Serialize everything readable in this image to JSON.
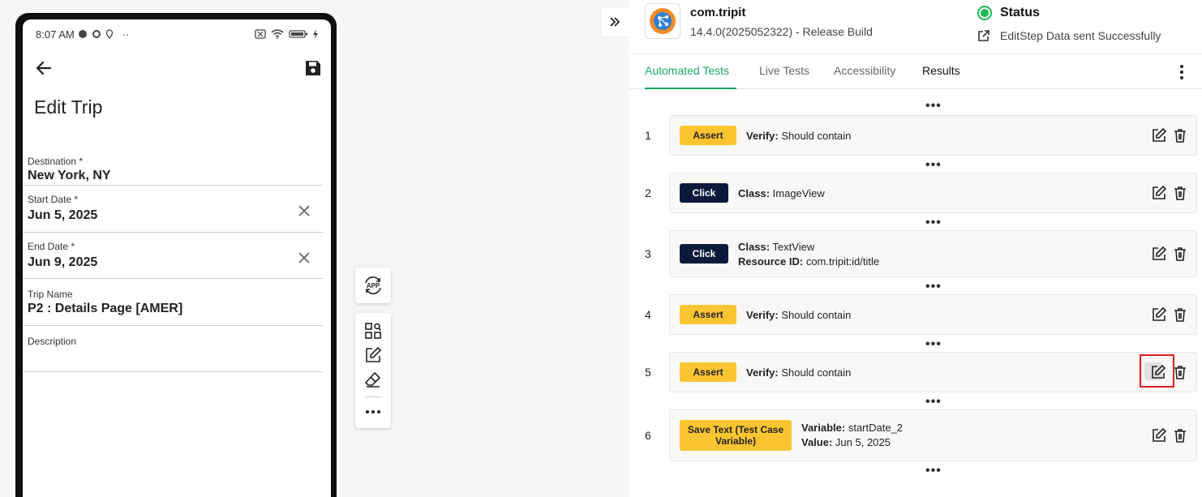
{
  "device": {
    "status_bar": {
      "time": "8:07 AM",
      "overflow": "··"
    },
    "screen_title": "Edit Trip",
    "fields": [
      {
        "label": "Destination *",
        "value": "New York, NY",
        "clearable": false
      },
      {
        "label": "Start Date *",
        "value": "Jun 5, 2025",
        "clearable": true
      },
      {
        "label": "End Date *",
        "value": "Jun 9, 2025",
        "clearable": true
      },
      {
        "label": "Trip Name",
        "value": "P2 : Details Page [AMER]",
        "clearable": false
      },
      {
        "label": "Description",
        "value": "",
        "clearable": false
      }
    ]
  },
  "toolbar": {
    "app_icon_text": "APP",
    "tools": [
      "grid-search-icon",
      "edit-icon",
      "eraser-icon",
      "more-icon"
    ]
  },
  "app": {
    "name": "com.tripit",
    "build": "14.4.0(2025052322) - Release Build",
    "status_title": "Status",
    "status_message": "EditStep Data sent Successfully",
    "status_color": "#1db954"
  },
  "tabs": [
    {
      "label": "Automated Tests",
      "active": true
    },
    {
      "label": "Live Tests",
      "active": false
    },
    {
      "label": "Accessibility",
      "active": false
    },
    {
      "label": "Results",
      "active": false
    }
  ],
  "steps": [
    {
      "num": "1",
      "badge": "Assert",
      "lines": [
        {
          "key": "Verify:",
          "value": "Should contain"
        }
      ]
    },
    {
      "num": "2",
      "badge": "Click",
      "lines": [
        {
          "key": "Class:",
          "value": "ImageView"
        }
      ]
    },
    {
      "num": "3",
      "badge": "Click",
      "lines": [
        {
          "key": "Class:",
          "value": "TextView"
        },
        {
          "key": "Resource ID:",
          "value": "com.tripit:id/title"
        }
      ]
    },
    {
      "num": "4",
      "badge": "Assert",
      "lines": [
        {
          "key": "Verify:",
          "value": "Should contain"
        }
      ]
    },
    {
      "num": "5",
      "badge": "Assert",
      "lines": [
        {
          "key": "Verify:",
          "value": "Should contain"
        }
      ],
      "highlighted": true
    },
    {
      "num": "6",
      "badge": "Save Text (Test Case Variable)",
      "lines": [
        {
          "key": "Variable:",
          "value": "startDate_2"
        },
        {
          "key": "Value:",
          "value": "Jun 5, 2025"
        }
      ]
    }
  ],
  "colors": {
    "accent": "#1aa866",
    "assert": "#fbc531",
    "click": "#0b1a3b",
    "highlight": "#e02020"
  }
}
